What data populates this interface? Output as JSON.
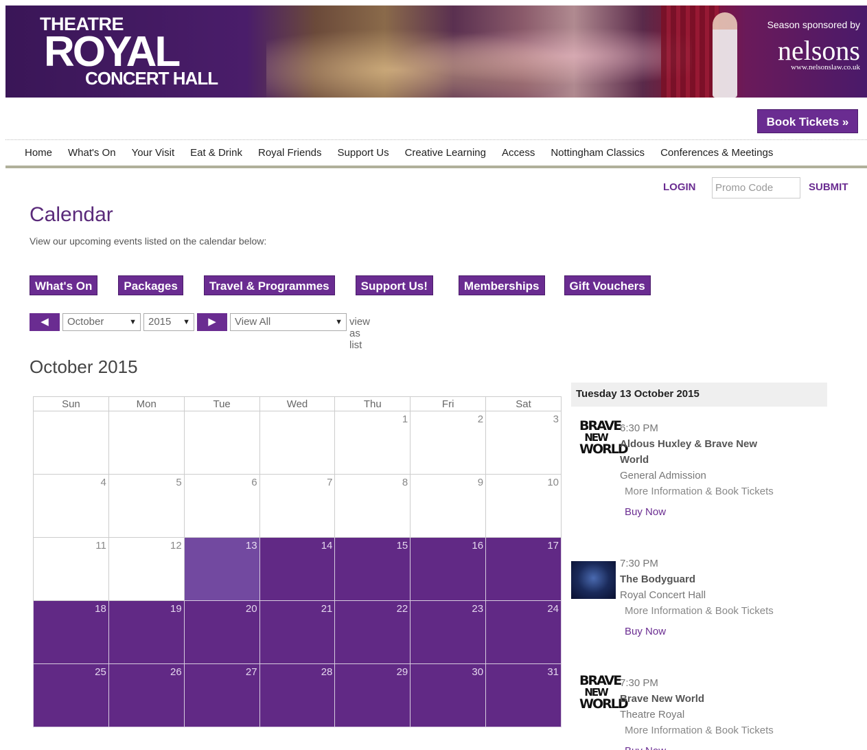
{
  "header": {
    "logo": {
      "line1": "THEATRE",
      "line2": "ROYAL",
      "line3": "CONCERT HALL"
    },
    "sponsor": {
      "label": "Season sponsored by",
      "name": "nelsons",
      "url": "www.nelsonslaw.co.uk"
    },
    "book_tickets": "Book Tickets »"
  },
  "nav": [
    "Home",
    "What's On",
    "Your Visit",
    "Eat & Drink",
    "Royal Friends",
    "Support Us",
    "Creative Learning",
    "Access",
    "Nottingham Classics",
    "Conferences & Meetings"
  ],
  "account": {
    "login": "LOGIN",
    "promo_placeholder": "Promo Code",
    "submit": "SUBMIT"
  },
  "page": {
    "title": "Calendar",
    "subtitle": "View our upcoming events listed on the calendar below:"
  },
  "categories": [
    "What's On",
    "Packages",
    "Travel & Programmes",
    "Support Us!",
    "Memberships",
    "Gift Vouchers"
  ],
  "controls": {
    "prev": "◀",
    "month": "October",
    "year": "2015",
    "next": "▶",
    "filter": "View All",
    "view_as_list": "view as list"
  },
  "calendar": {
    "title": "October 2015",
    "weekdays": [
      "Sun",
      "Mon",
      "Tue",
      "Wed",
      "Thu",
      "Fri",
      "Sat"
    ],
    "weeks": [
      [
        "",
        "",
        "",
        "",
        "1",
        "2",
        "3"
      ],
      [
        "4",
        "5",
        "6",
        "7",
        "8",
        "9",
        "10"
      ],
      [
        "11",
        "12",
        "13",
        "14",
        "15",
        "16",
        "17"
      ],
      [
        "18",
        "19",
        "20",
        "21",
        "22",
        "23",
        "24"
      ],
      [
        "25",
        "26",
        "27",
        "28",
        "29",
        "30",
        "31"
      ]
    ],
    "selected_day": "13",
    "event_days_from": 13,
    "colors": {
      "event": "#612985",
      "selected": "#7249a0",
      "accent": "#6a2c91"
    }
  },
  "events_panel": {
    "date": "Tuesday 13 October 2015",
    "events": [
      {
        "image": "brave-new-world-logo",
        "img_text": [
          "BRAVE",
          "NEW",
          "WORLD"
        ],
        "time": "6:30 PM",
        "name": "Aldous Huxley & Brave New World",
        "venue": "General Admission",
        "more": "More Information & Book Tickets",
        "buy": "Buy Now"
      },
      {
        "image": "bodyguard-photo",
        "img_text": [],
        "time": "7:30 PM",
        "name": "The Bodyguard",
        "venue": "Royal Concert Hall",
        "more": "More Information & Book Tickets",
        "buy": "Buy Now"
      },
      {
        "image": "brave-new-world-logo",
        "img_text": [
          "BRAVE",
          "NEW",
          "WORLD"
        ],
        "time": "7:30 PM",
        "name": "Brave New World",
        "venue": "Theatre Royal",
        "more": "More Information & Book Tickets",
        "buy": "Buy Now"
      }
    ]
  }
}
